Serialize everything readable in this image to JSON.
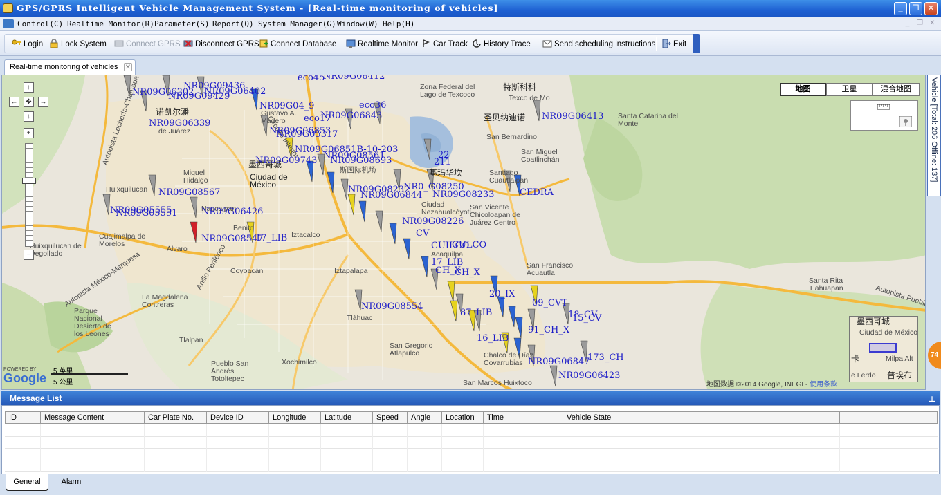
{
  "window": {
    "title": "GPS/GPRS Intelligent Vehicle Management System - [Real-time monitoring of vehicles]",
    "min_label": "_",
    "restore_label": "❐",
    "close_label": "✕"
  },
  "menu": {
    "items": [
      "Control(C)",
      "Realtime Monitor(R)",
      "Parameter(S)",
      "Report(Q)",
      "System Manager(G)",
      "Window(W)",
      "Help(H)"
    ]
  },
  "toolbar": {
    "login": "Login",
    "lock_system": "Lock System",
    "connect_gprs": "Connect GPRS",
    "disconnect_gprs": "Disconnect GPRS",
    "connect_database": "Connect Database",
    "realtime_monitor": "Realtime Monitor",
    "car_track": "Car Track",
    "history_trace": "History Trace",
    "send_scheduling": "Send scheduling instructions",
    "exit": "Exit"
  },
  "doc_tab": {
    "label": "Real-time monitoring of vehicles",
    "close": "✕"
  },
  "map": {
    "map_types": [
      "地图",
      "卫星",
      "混合地图"
    ],
    "selected_map_type": "地图",
    "scale": {
      "top": "5 英里",
      "bottom": "5 公里"
    },
    "copyright": "地图数据 ©2014 Google, INEGI - ",
    "terms": "使用条款",
    "powered_by": "POWERED BY",
    "google": "Google",
    "overview_labels": [
      "墨西哥城",
      "Ciudad de México",
      "卡",
      "Milpa Alt",
      "e Lerdo",
      "普埃布"
    ],
    "place_labels": [
      "Zona Federal del Lago de Texcoco",
      "特斯科科",
      "Texco de Mo",
      "圣贝纳迪诺",
      "San Bernardino",
      "San Miguel Coatlinchán",
      "Santa Catarina del Monte",
      "墨西哥城",
      "Ciudad de México",
      "斯国际机场",
      "基玛华坎",
      "Santiago Cuautlalpan",
      "San Vicente Chicoloapan de Juárez Centro",
      "Miguel Hidalgo",
      "诺凯尔潘",
      "de Juárez",
      "Gustavo A. Madero",
      "Huixquilucan",
      "Naucalpan",
      "Iztacalco",
      "Benito",
      "Cuajimalpa de Morelos",
      "Álvaro",
      "Coyoacán",
      "Iztapalapa",
      "La Magdalena Contreras",
      "Parque Nacional Desierto de los Leones",
      "Tláhuac",
      "Tlalpan",
      "Xochimilco",
      "Pueblo San Andrés Totoltepec",
      "San Gregorio Atlapulco",
      "San Francisco Acuautla",
      "Santa Rita Tlahuapan",
      "Chalco de Díaz Covarrubias",
      "San Marcos Huixtoco",
      "Huixquilucan de Degollado",
      "Acaquilpa",
      "Ciudad Nezahualcóyotl",
      "Autopista Puebla-México",
      "Autopista Lechería-Chamapa",
      "Autopista México-Marquesa",
      "Anillo Periférico",
      "Circuito Interior"
    ],
    "vehicle_labels": [
      "NR09G09436",
      "NR09G06302",
      "NR09G06402",
      "NR09G09429",
      "eco45",
      "NR09G08412",
      "NR09G04_9",
      "eco36",
      "NR09G06843",
      "NR09G06339",
      "eco17",
      "NR09G06853",
      "NR09G05317",
      "NR09G06851B-10-203",
      "NR09G08561",
      "NR09G08693",
      "NR09G09743",
      "22",
      "211",
      "NR0_G08250",
      "NR09G06844",
      "NR09G08233",
      "NR09G08232",
      "NR09G08226",
      "NR09G08567",
      "NR09G05555",
      "NR09G05551",
      "NR09G06426",
      "NR09G08547",
      "17_LIB",
      "NR09G06413",
      "NR09G08554",
      "17_LIB",
      "CH_X",
      "20_IX",
      "09_CVT",
      "18_CV",
      "15_CV",
      "91_CH_X",
      "16_LIB",
      "173_CH",
      "NR09G06847",
      "NR09G06423",
      "CEDRA",
      "CULCO",
      "CUILCO",
      "CV",
      "87_LIB",
      "CH_X"
    ]
  },
  "side_panel": {
    "label": "Vehicle [Total: 206 Offline: 137]"
  },
  "badge": {
    "value": "74"
  },
  "message_list": {
    "title": "Message List",
    "pin": "⊥",
    "columns": [
      "ID",
      "Message Content",
      "Car Plate No.",
      "Device ID",
      "Longitude",
      "Latitude",
      "Speed",
      "Angle",
      "Location",
      "Time",
      "Vehicle State"
    ]
  },
  "bottom_tabs": {
    "general": "General",
    "alarm": "Alarm"
  },
  "colors": {
    "vehicle_label": "#1c1cc8",
    "title_bar": "#1e60d2"
  }
}
